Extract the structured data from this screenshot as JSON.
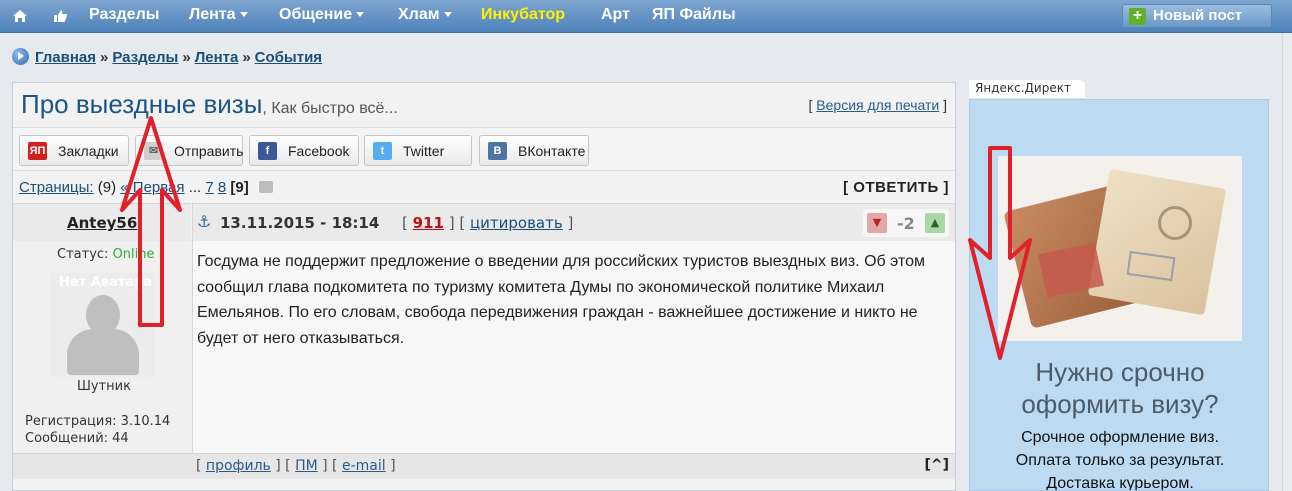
{
  "nav": {
    "items": [
      {
        "label": "Разделы",
        "dropdown": false
      },
      {
        "label": "Лента",
        "dropdown": true
      },
      {
        "label": "Общение",
        "dropdown": true
      },
      {
        "label": "Хлам",
        "dropdown": true
      },
      {
        "label": "Инкубатор",
        "dropdown": false,
        "highlight": "#fff200"
      },
      {
        "label": "Арт",
        "dropdown": false
      },
      {
        "label": "ЯП Файлы",
        "dropdown": false
      }
    ],
    "new_post": "Новый пост",
    "icons": [
      "home-icon",
      "thumbs-up-icon"
    ]
  },
  "breadcrumb": {
    "items": [
      "Главная",
      "Разделы",
      "Лента",
      "События"
    ],
    "sep": "»"
  },
  "topic": {
    "title": "Про выездные визы",
    "desc": ", Как быстро всё...",
    "print_link": "Версия для печати"
  },
  "share": [
    {
      "label": "Закладки",
      "icon": "yap-icon",
      "color": "#d21f1f"
    },
    {
      "label": "Отправить",
      "icon": "mail-icon",
      "color": "#c9c9c9"
    },
    {
      "label": "Facebook",
      "icon": "facebook-icon",
      "color": "#3b5998"
    },
    {
      "label": "Twitter",
      "icon": "twitter-icon",
      "color": "#55acee"
    },
    {
      "label": "ВКонтакте",
      "icon": "vk-icon",
      "color": "#4c75a3"
    }
  ],
  "pagination": {
    "label": "Страницы:",
    "count": "(9)",
    "first": "« Первая",
    "ellipsis": "...",
    "p7": "7",
    "p8": "8",
    "current": "[9]",
    "reply": "[ ОТВЕТИТЬ ]"
  },
  "post": {
    "author": "Antey56",
    "date": "13.11.2015 - 18:14",
    "number": "911",
    "quote": "цитировать",
    "rating": "-2",
    "status_label": "Статус:",
    "status_value": "Online",
    "avatar_label": "Нет Аватара",
    "rank": "Шутник",
    "registration": "Регистрация: 3.10.14",
    "messages": "Сообщений: 44",
    "text": "Госдума не поддержит предложение о введении для российских туристов выездных виз. Об этом сообщил глава подкомитета по туризму комитета Думы по экономической политике Михаил Емельянов. По его словам, свобода передвижения граждан - важнейшее достижение и никто не будет от него отказываться.",
    "footer_links": [
      "профиль",
      "ПМ",
      "e-mail"
    ],
    "to_top": "[^]"
  },
  "ad": {
    "label": "Яндекс.Директ",
    "heading_line1": "Нужно срочно",
    "heading_line2": "оформить визу?",
    "lines": [
      "Срочное оформление виз.",
      "Оплата только за результат.",
      "Доставка курьером."
    ]
  },
  "colors": {
    "accent": "#1e5587",
    "nav_bg": "#4f82ba",
    "highlight": "#fff200",
    "online": "#2fae2f",
    "arrow": "#e0202a"
  }
}
